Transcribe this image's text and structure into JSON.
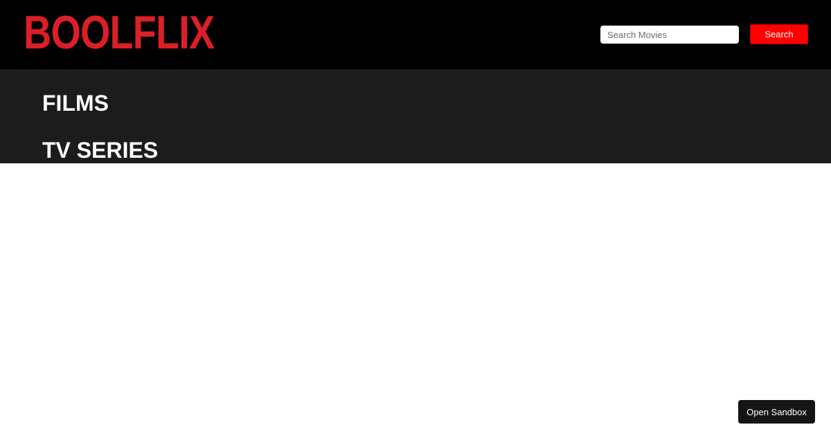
{
  "header": {
    "logo_text": "BOOLFLIX",
    "search": {
      "placeholder": "Search Movies",
      "value": "",
      "button_label": "Search"
    }
  },
  "nav": {
    "items": [
      {
        "label": "FILMS"
      },
      {
        "label": "TV SERIES"
      }
    ]
  },
  "sandbox": {
    "button_label": "Open Sandbox"
  },
  "colors": {
    "brand": "#db1f27",
    "header_bg": "#000000",
    "nav_bg": "#1c1c1c",
    "search_button_bg": "#ff0000",
    "sandbox_button_bg": "#151515"
  }
}
